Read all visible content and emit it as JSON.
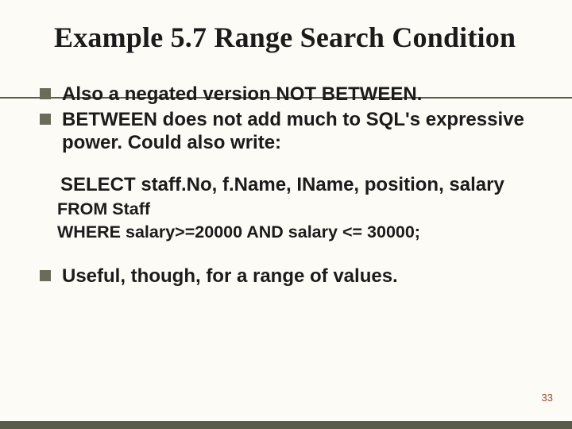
{
  "title": "Example 5.7  Range Search Condition",
  "bullets": [
    "Also a negated version NOT BETWEEN.",
    "BETWEEN does not add much to SQL's expressive power. Could also write:"
  ],
  "sql": {
    "select": "SELECT staff.No, f.Name, IName, position, salary",
    "from": "FROM Staff",
    "where": "WHERE salary>=20000 AND salary <= 30000;"
  },
  "closing": "Useful, though, for a range of values.",
  "page_number": "33"
}
